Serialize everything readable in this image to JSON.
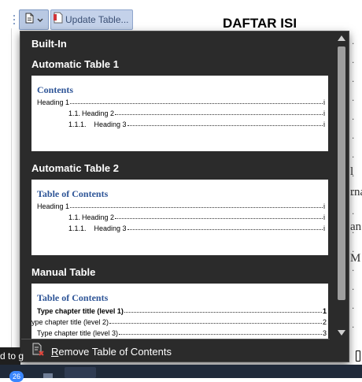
{
  "content_control": {
    "menu_icon": "document-icon",
    "dropdown_icon": "chevron-down-icon",
    "update_icon": "update-table-icon",
    "update_label": "Update Table..."
  },
  "document": {
    "title": "DAFTAR ISI",
    "fragments": [
      "l",
      "rna",
      "an",
      "M ."
    ],
    "status_text": "d to g"
  },
  "gallery": {
    "section": "Built-In",
    "auto1": {
      "heading": "Automatic Table 1",
      "thumb_title": "Contents",
      "rows": [
        {
          "num": "",
          "text": "Heading 1",
          "page": "i"
        },
        {
          "num": "1.1.",
          "text": "Heading 2",
          "page": "i"
        },
        {
          "num": "1.1.1.",
          "text": "Heading 3",
          "page": "i"
        }
      ]
    },
    "auto2": {
      "heading": "Automatic Table 2",
      "thumb_title": "Table of Contents",
      "rows": [
        {
          "num": "",
          "text": "Heading 1",
          "page": "i"
        },
        {
          "num": "1.1.",
          "text": "Heading 2",
          "page": "i"
        },
        {
          "num": "1.1.1.",
          "text": "Heading 3",
          "page": "i"
        }
      ]
    },
    "manual": {
      "heading": "Manual Table",
      "thumb_title": "Table of Contents",
      "rows": [
        {
          "text": "Type chapter title (level 1)",
          "page": "1"
        },
        {
          "text": "ype chapter title (level 2)",
          "page": "2"
        },
        {
          "text": "Type chapter title (level 3)",
          "page": "3"
        }
      ]
    },
    "remove": {
      "icon": "remove-toc-icon",
      "accel": "R",
      "label_rest": "emove Table of Contents"
    }
  },
  "taskbar": {
    "badge": "26"
  }
}
